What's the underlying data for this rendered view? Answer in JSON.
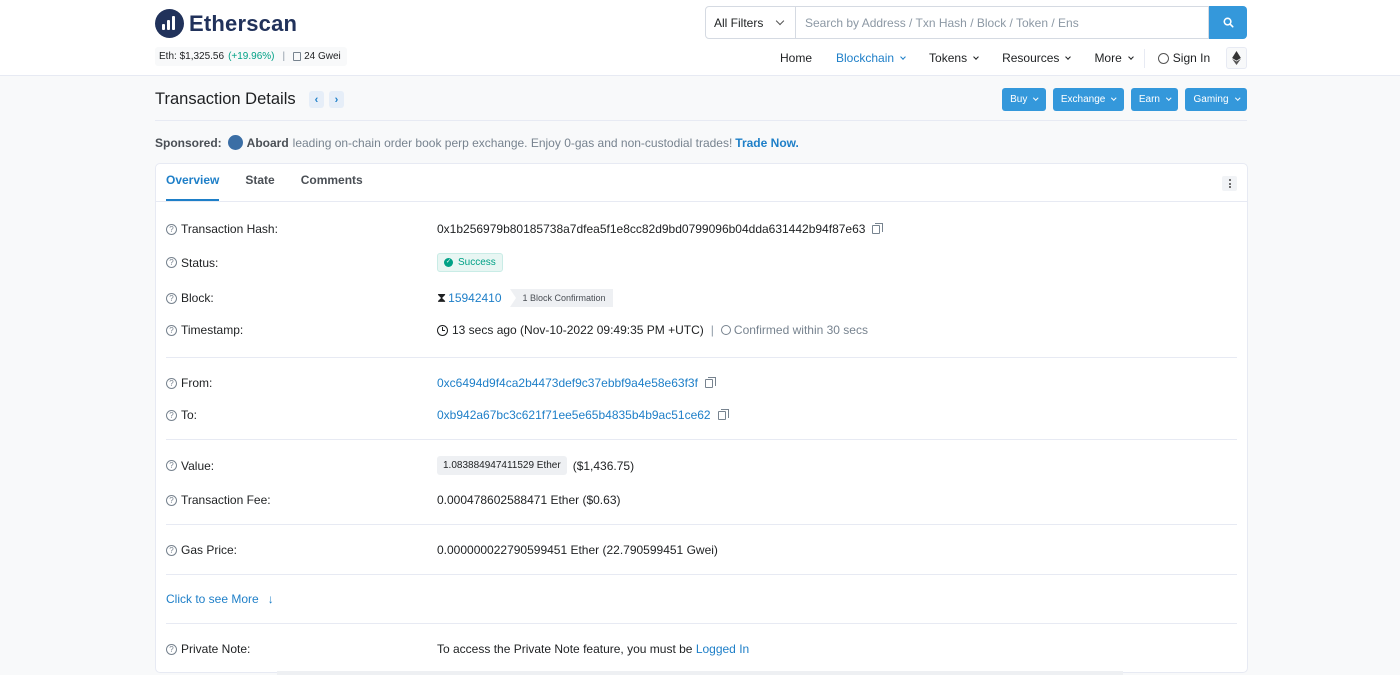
{
  "header": {
    "logo_text": "Etherscan",
    "eth_price_label": "Eth: $1,325.56",
    "eth_price_change": "(+19.96%)",
    "separator": "|",
    "gas": "24 Gwei",
    "search": {
      "filter_label": "All Filters",
      "placeholder": "Search by Address / Txn Hash / Block / Token / Ens"
    },
    "nav": {
      "home": "Home",
      "blockchain": "Blockchain",
      "tokens": "Tokens",
      "resources": "Resources",
      "more": "More",
      "sign_in": "Sign In"
    }
  },
  "page": {
    "title": "Transaction Details",
    "prev_symbol": "‹",
    "next_symbol": "›",
    "buttons": [
      "Buy",
      "Exchange",
      "Earn",
      "Gaming"
    ]
  },
  "sponsored": {
    "label": "Sponsored:",
    "brand": "Aboard",
    "text": "leading on-chain order book perp exchange. Enjoy 0-gas and non-custodial trades!",
    "cta": "Trade Now."
  },
  "tabs": [
    "Overview",
    "State",
    "Comments"
  ],
  "details": {
    "tx_hash_label": "Transaction Hash:",
    "tx_hash": "0x1b256979b80185738a7dfea5f1e8cc82d9bd0799096b04dda631442b94f87e63",
    "status_label": "Status:",
    "status": "Success",
    "block_label": "Block:",
    "block": "15942410",
    "block_confirmations": "1 Block Confirmation",
    "timestamp_label": "Timestamp:",
    "timestamp": "13 secs ago (Nov-10-2022 09:49:35 PM +UTC)",
    "confirmed_within": "Confirmed within 30 secs",
    "from_label": "From:",
    "from": "0xc6494d9f4ca2b4473def9c37ebbf9a4e58e63f3f",
    "to_label": "To:",
    "to": "0xb942a67bc3c621f71ee5e65b4835b4b9ac51ce62",
    "value_label": "Value:",
    "value_eth": "1.083884947411529 Ether",
    "value_usd": "($1,436.75)",
    "fee_label": "Transaction Fee:",
    "fee": "0.000478602588471 Ether ($0.63)",
    "gas_price_label": "Gas Price:",
    "gas_price": "0.000000022790599451 Ether (22.790599451 Gwei)",
    "more_link": "Click to see More",
    "private_note_label": "Private Note:",
    "private_note_text": "To access the Private Note feature, you must be",
    "private_note_link": "Logged In"
  },
  "colors": {
    "accent": "#3498db",
    "link": "#1e7fc8",
    "success": "#00a186",
    "brand_dark": "#21325b"
  },
  "icons": {
    "search": "search-icon",
    "copy": "copy-icon",
    "help": "question-circle-icon",
    "ethereum": "ethereum-icon"
  }
}
